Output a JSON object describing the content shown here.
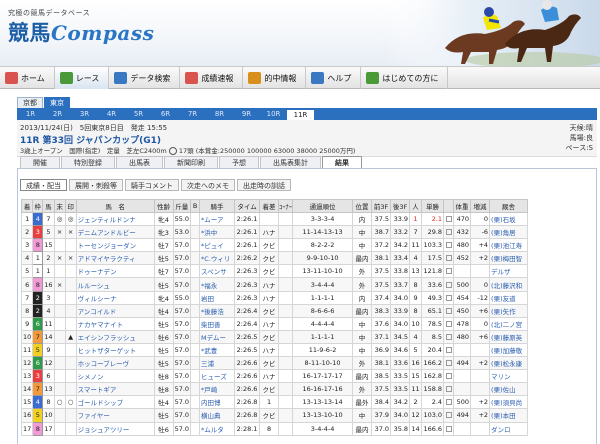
{
  "header": {
    "tagline": "究極の競馬データベース",
    "logo_a": "競馬",
    "logo_b": "Compass"
  },
  "gnav": [
    {
      "label": "ホーム",
      "icon": "home-icon",
      "color": "#d9534f",
      "on": false
    },
    {
      "label": "レース",
      "icon": "race-icon",
      "color": "#4a9a3a",
      "on": true
    },
    {
      "label": "データ検索",
      "icon": "search-icon",
      "color": "#3b78c2",
      "on": false
    },
    {
      "label": "成績速報",
      "icon": "results-icon",
      "color": "#d9534f",
      "on": false
    },
    {
      "label": "的中情報",
      "icon": "hit-icon",
      "color": "#d88f1c",
      "on": false
    },
    {
      "label": "ヘルプ",
      "icon": "help-icon",
      "color": "#3b78c2",
      "on": false
    },
    {
      "label": "はじめての方に",
      "icon": "beginner-icon",
      "color": "#4a9a3a",
      "on": false
    }
  ],
  "venue_tabs": [
    {
      "label": "京都",
      "on": false
    },
    {
      "label": "東京",
      "on": true
    }
  ],
  "race_tabs": [
    "1R",
    "2R",
    "3R",
    "4R",
    "5R",
    "6R",
    "7R",
    "8R",
    "9R",
    "10R",
    "11R"
  ],
  "race_tab_active": "11R",
  "info": {
    "date_line": "2013/11/24(日)　5回東京8日目　発走 15:55",
    "race_no": "11R",
    "race_name": "第33回 ジャパンカップ(G1)",
    "cond_line": "3歳上オープン　国際(指定)　定量　芝左C2400m",
    "cond_tail": "17頭 (本賞金:250000 100000 63000 38000 25000万円)",
    "weather": "天候:晴",
    "track": "馬場:良",
    "pace": "ペース:S"
  },
  "section_tabs": [
    "開催",
    "特別登録",
    "出馬表",
    "新聞印刷",
    "予想",
    "出馬表集計",
    "結果"
  ],
  "section_tab_active": "結果",
  "content_tabs": [
    "成績・配当",
    "展開・刺殺等",
    "騎手コメント",
    "次走へのメモ",
    "出走時の訓話"
  ],
  "content_tab_active": "成績・配当",
  "columns": [
    "着",
    "枠",
    "馬",
    "末",
    "印",
    "馬　名",
    "性齢",
    "斤量",
    "B",
    "騎手",
    "タイム",
    "着差",
    "ｺｰﾅｰ",
    "通過順位",
    "位置",
    "前3F",
    "後3F",
    "人",
    "単勝",
    "",
    "体重",
    "増減",
    "厩舎"
  ],
  "rows": [
    [
      "1",
      "4",
      "7",
      "◎",
      "◎",
      "ジェンティルドンナ",
      "牝4",
      "55.0",
      "",
      "*ムーア",
      "2:26.1",
      "",
      "",
      "3-3-3-4",
      "内",
      "37.5",
      "33.9",
      "1",
      "2.1",
      "",
      "470",
      "0",
      "(栗)石坂"
    ],
    [
      "2",
      "3",
      "5",
      "×",
      "×",
      "デニムアンドルビー",
      "牝3",
      "53.0",
      "",
      "*浜中",
      "2:26.1",
      "ハナ",
      "",
      "11-14-13-13",
      "中",
      "38.7",
      "33.2",
      "7",
      "29.8",
      "",
      "432",
      "-6",
      "(栗)角居"
    ],
    [
      "3",
      "8",
      "15",
      "",
      "",
      "トーセンジョーダン",
      "牡7",
      "57.0",
      "",
      "*ピュイ",
      "2:26.1",
      "クビ",
      "",
      "8-2-2-2",
      "中",
      "37.2",
      "34.2",
      "11",
      "103.3",
      "",
      "480",
      "+4",
      "(栗)池江寿"
    ],
    [
      "4",
      "1",
      "2",
      "×",
      "×",
      "アドマイヤラクティ",
      "牡5",
      "57.0",
      "",
      "*C.ウィリ",
      "2:26.2",
      "クビ",
      "",
      "9-9-10-10",
      "最内",
      "38.1",
      "33.4",
      "4",
      "17.5",
      "",
      "452",
      "+2",
      "(栗)梅田智"
    ],
    [
      "5",
      "1",
      "1",
      "",
      "",
      "ドゥーナデン",
      "牡7",
      "57.0",
      "",
      "スペンサ",
      "2:26.3",
      "クビ",
      "",
      "13-11-10-10",
      "外",
      "37.5",
      "33.8",
      "13",
      "121.8",
      "",
      "",
      "",
      "デルザ"
    ],
    [
      "6",
      "8",
      "16",
      "×",
      "",
      "ルルーシュ",
      "牡5",
      "57.0",
      "",
      "*福永",
      "2:26.3",
      "ハナ",
      "",
      "3-4-4-4",
      "外",
      "37.5",
      "33.7",
      "8",
      "33.6",
      "",
      "500",
      "0",
      "(北)藤沢和"
    ],
    [
      "7",
      "2",
      "3",
      "",
      "",
      "ヴィルシーナ",
      "牝4",
      "55.0",
      "",
      "岩田",
      "2:26.3",
      "ハナ",
      "",
      "1-1-1-1",
      "内",
      "37.4",
      "34.0",
      "9",
      "49.3",
      "",
      "454",
      "-12",
      "(栗)友道"
    ],
    [
      "8",
      "2",
      "4",
      "",
      "",
      "アンコイルド",
      "牡4",
      "57.0",
      "",
      "*後藤浩",
      "2:26.4",
      "クビ",
      "",
      "8-6-6-6",
      "最内",
      "38.3",
      "33.9",
      "8",
      "65.1",
      "",
      "450",
      "+6",
      "(栗)矢作"
    ],
    [
      "9",
      "6",
      "11",
      "",
      "",
      "ナカヤマナイト",
      "牡5",
      "57.0",
      "",
      "柴田善",
      "2:26.4",
      "ハナ",
      "",
      "4-4-4-4",
      "中",
      "37.6",
      "34.0",
      "10",
      "78.5",
      "",
      "478",
      "0",
      "(北)二ノ宮"
    ],
    [
      "10",
      "7",
      "14",
      "",
      "▲",
      "エイシンフラッシュ",
      "牡6",
      "57.0",
      "",
      "Mデムー",
      "2:26.5",
      "クビ",
      "",
      "1-1-1-1",
      "中",
      "37.1",
      "34.5",
      "4",
      "8.5",
      "",
      "480",
      "+6",
      "(栗)藤原英"
    ],
    [
      "11",
      "5",
      "9",
      "",
      "",
      "ヒットザターゲット",
      "牡5",
      "57.0",
      "",
      "*武豊",
      "2:26.5",
      "ハナ",
      "",
      "11-9-6-2",
      "中",
      "36.9",
      "34.6",
      "5",
      "20.4",
      "",
      "",
      "",
      "(栗)加藤敬"
    ],
    [
      "12",
      "6",
      "12",
      "",
      "",
      "ホッコーブレーヴ",
      "牡5",
      "57.0",
      "",
      "三浦",
      "2:26.6",
      "クビ",
      "",
      "8-11-10-10",
      "外",
      "38.1",
      "33.6",
      "16",
      "166.2",
      "",
      "494",
      "+2",
      "(栗)松永康"
    ],
    [
      "13",
      "3",
      "6",
      "",
      "",
      "シメノン",
      "牡8",
      "57.0",
      "",
      "ヒューズ",
      "2:26.6",
      "ハナ",
      "",
      "16-17-17-17",
      "最内",
      "38.5",
      "33.5",
      "15",
      "162.8",
      "",
      "",
      "",
      "マリン"
    ],
    [
      "14",
      "7",
      "13",
      "",
      "",
      "スマートギア",
      "牡8",
      "57.0",
      "",
      "*戸崎",
      "2:26.6",
      "クビ",
      "",
      "16-16-17-16",
      "外",
      "37.5",
      "33.5",
      "11",
      "158.8",
      "",
      "",
      "",
      "(栗)佐山"
    ],
    [
      "15",
      "4",
      "8",
      "○",
      "○",
      "ゴールドシップ",
      "牡4",
      "57.0",
      "",
      "内田博",
      "2:26.8",
      "1",
      "",
      "13-13-13-14",
      "最外",
      "38.4",
      "34.2",
      "2",
      "2.4",
      "",
      "500",
      "+2",
      "(栗)須貝尚"
    ],
    [
      "16",
      "5",
      "10",
      "",
      "",
      "ファイヤー",
      "牡5",
      "57.0",
      "",
      "横山典",
      "2:26.8",
      "クビ",
      "",
      "13-13-10-10",
      "中",
      "37.9",
      "34.0",
      "12",
      "103.0",
      "",
      "494",
      "+2",
      "(栗)本田"
    ],
    [
      "17",
      "8",
      "17",
      "",
      "",
      "ジョシュアツリー",
      "牡6",
      "57.0",
      "",
      "*ムルタ",
      "2:28.1",
      "8",
      "",
      "3-4-4-4",
      "最内",
      "37.0",
      "35.8",
      "14",
      "166.6",
      "",
      "",
      "",
      "ダンロ"
    ]
  ],
  "waku_colors": {
    "1": "#ffffff",
    "2": "#222222",
    "3": "#e84040",
    "4": "#3a6bd1",
    "5": "#f2d023",
    "6": "#2f9a4a",
    "7": "#f29a3a",
    "8": "#f29ad6"
  },
  "waku_text": {
    "1": "#222",
    "2": "#fff",
    "3": "#fff",
    "4": "#fff",
    "5": "#222",
    "6": "#fff",
    "7": "#222",
    "8": "#222"
  }
}
